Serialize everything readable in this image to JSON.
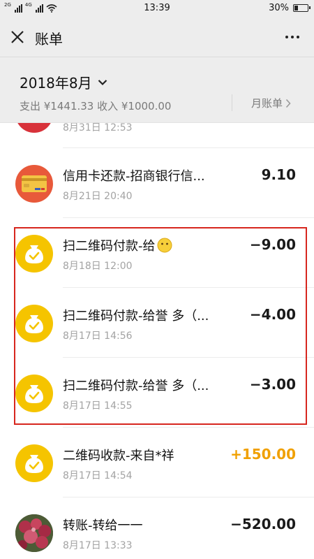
{
  "status_bar": {
    "signal_label_1": "2G",
    "signal_label_2": "4G",
    "time": "13:39",
    "battery_percent": "30%",
    "battery_level": 0.3
  },
  "nav": {
    "title": "账单"
  },
  "summary": {
    "month": "2018年8月",
    "totals": "支出 ¥1441.33 收入 ¥1000.00",
    "monthly_bill_label": "月账单"
  },
  "transactions": [
    {
      "title": "",
      "time": "8月31日 12:53",
      "amount": "",
      "avatar": "red-circle-icon"
    },
    {
      "title": "信用卡还款-招商银行信...",
      "time": "8月21日 20:40",
      "amount": "9.10",
      "avatar": "credit-card-icon"
    },
    {
      "title": "扫二维码付款-给",
      "time": "8月18日 12:00",
      "amount": "-9.00",
      "avatar": "money-bag-icon",
      "emoji": "😶"
    },
    {
      "title": "扫二维码付款-给誉 多（...",
      "time": "8月17日 14:56",
      "amount": "-4.00",
      "avatar": "money-bag-icon"
    },
    {
      "title": "扫二维码付款-给誉 多（...",
      "time": "8月17日 14:55",
      "amount": "-3.00",
      "avatar": "money-bag-icon"
    },
    {
      "title": "二维码收款-来自*祥",
      "time": "8月17日 14:54",
      "amount": "+150.00",
      "avatar": "money-bag-icon"
    },
    {
      "title": "转账-转给一一",
      "time": "8月17日 13:33",
      "amount": "-520.00",
      "avatar": "flower-photo-avatar"
    }
  ],
  "colors": {
    "income": "#f0a000",
    "highlight": "#d7261e",
    "money_bag": "#f5c400"
  }
}
